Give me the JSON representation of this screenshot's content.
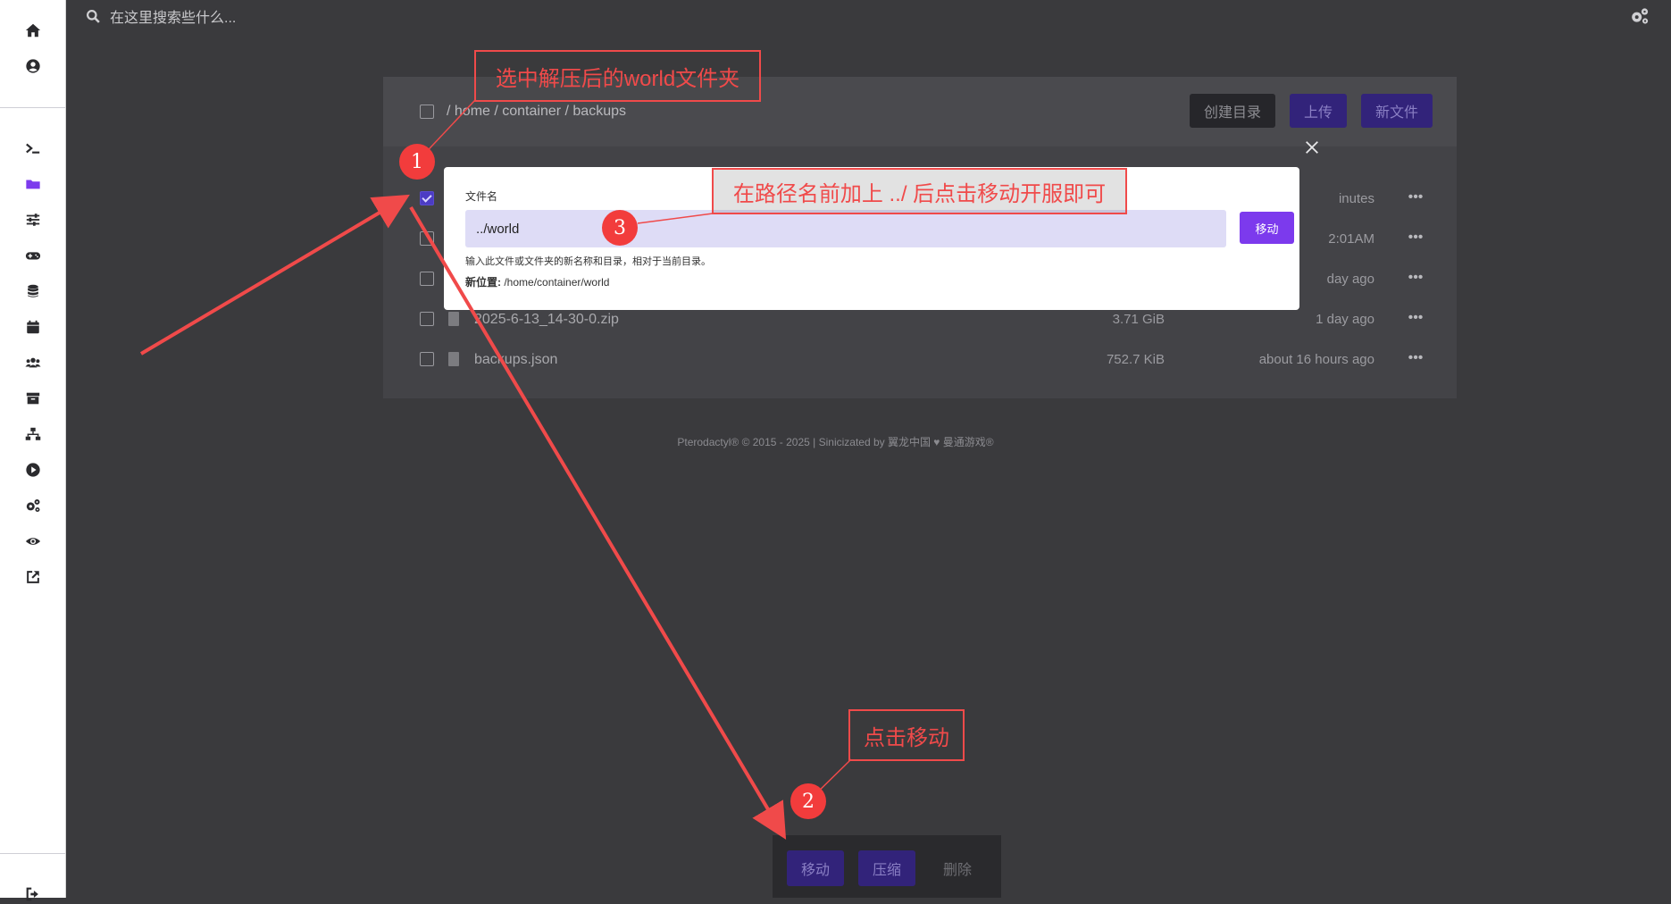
{
  "topbar": {
    "search_placeholder": "在这里搜索些什么..."
  },
  "sidebar": {
    "top_icons": [
      "home-icon",
      "user-circle-icon"
    ],
    "nav_icons": [
      "terminal-icon",
      "folder-icon",
      "sliders-icon",
      "gamepad-icon",
      "database-icon",
      "calendar-icon",
      "users-icon",
      "archive-icon",
      "network-icon",
      "play-icon",
      "cogs-icon",
      "eye-icon",
      "external-link-icon"
    ],
    "active_icon": "folder-icon",
    "accent": "#7c3aed"
  },
  "file_manager": {
    "breadcrumb": "/ home / container / backups",
    "buttons": {
      "create_dir": "创建目录",
      "upload": "上传",
      "new_file": "新文件"
    },
    "rows": [
      {
        "name": "",
        "size": "",
        "date": "inutes",
        "checked": true
      },
      {
        "name": "",
        "size": "",
        "date": "2:01AM",
        "checked": false
      },
      {
        "name": "",
        "size": "",
        "date": "day ago",
        "checked": false
      },
      {
        "name": "2025-6-13_14-30-0.zip",
        "size": "3.71 GiB",
        "date": "1 day ago",
        "checked": false
      },
      {
        "name": "backups.json",
        "size": "752.7 KiB",
        "date": "about 16 hours ago",
        "checked": false
      }
    ]
  },
  "footer": {
    "text": "Pterodactyl® © 2015 - 2025 | Sinicizated by 翼龙中国 ♥ 曼通游戏®"
  },
  "modal": {
    "label": "文件名",
    "input_value": "../world",
    "submit": "移动",
    "hint": "输入此文件或文件夹的新名称和目录，相对于当前目录。",
    "location_label": "新位置:",
    "location_value": "/home/container/world"
  },
  "bottom_bar": {
    "move": "移动",
    "compress": "压缩",
    "delete": "删除"
  },
  "annotations": {
    "step1_text": "选中解压后的world文件夹",
    "step2_text": "点击移动",
    "step3_text": "在路径名前加上 ../ 后点击移动开服即可",
    "badges": [
      "1",
      "2",
      "3"
    ],
    "color": "#f04a4a"
  }
}
